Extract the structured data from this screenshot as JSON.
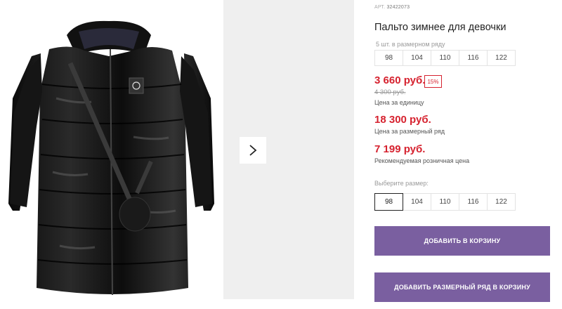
{
  "product": {
    "art_label": "АРТ.",
    "art_number": "32422073",
    "title": "Пальто зимнее для девочки"
  },
  "size_row_note": "5 шт. в размерном ряду",
  "sizes": [
    "98",
    "104",
    "110",
    "116",
    "122"
  ],
  "prices": {
    "unit_price": "3 660 руб.",
    "discount": "15%",
    "old_price": "4 300 руб.",
    "unit_caption": "Цена за единицу",
    "row_price": "18 300 руб.",
    "row_caption": "Цена за размерный ряд",
    "retail_price": "7 199 руб.",
    "retail_caption": "Рекомендуемая розничная цена"
  },
  "size_select": {
    "label": "Выберите размер:",
    "selected": "98"
  },
  "buttons": {
    "add_to_cart": "ДОБАВИТЬ В КОРЗИНУ",
    "add_row_to_cart": "ДОБАВИТЬ РАЗМЕРНЫЙ РЯД В КОРЗИНУ"
  },
  "colors": {
    "accent": "#7a5fa0",
    "price": "#d6222f",
    "thumb_bg": "#efefef"
  },
  "icons": {
    "next": "chevron-right-icon",
    "badge": "bear-badge-icon"
  }
}
